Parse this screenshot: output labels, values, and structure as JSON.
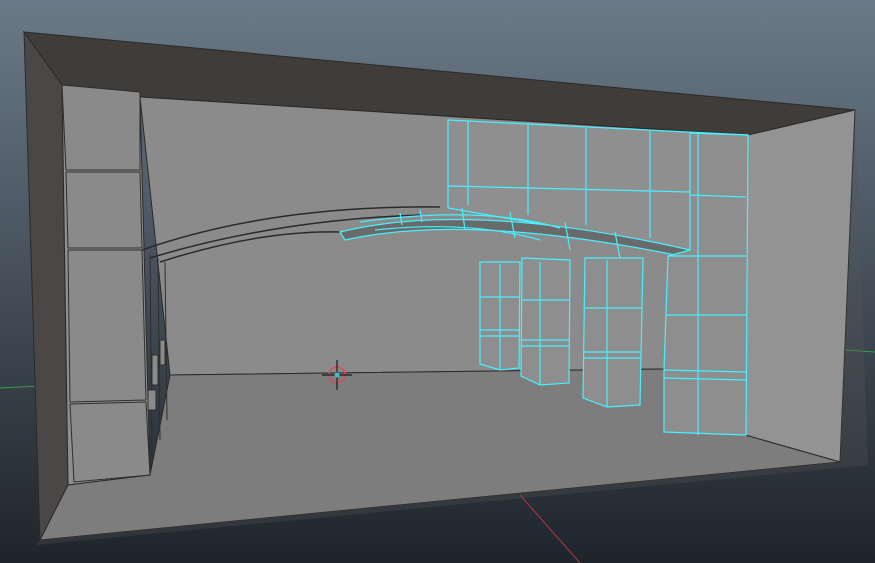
{
  "viewport": {
    "type": "3d-perspective-viewport",
    "background_top": "#6b7a88",
    "background_bottom": "#1e242b",
    "grid_x_axis_color": "#b03a3a",
    "grid_y_axis_color": "#3a9a4a",
    "selection_wire_color": "#47f0ff",
    "unselected_wire_color": "#2a2a2a"
  },
  "scene": {
    "room_color_wall": "#939393",
    "room_color_back": "#8b8b8b",
    "room_color_floor": "#7d7d7d",
    "room_color_ceiling": "#403c3a",
    "selected_object": "arch-colonnade",
    "pivot_icon": "manipulator-pivot-icon"
  }
}
